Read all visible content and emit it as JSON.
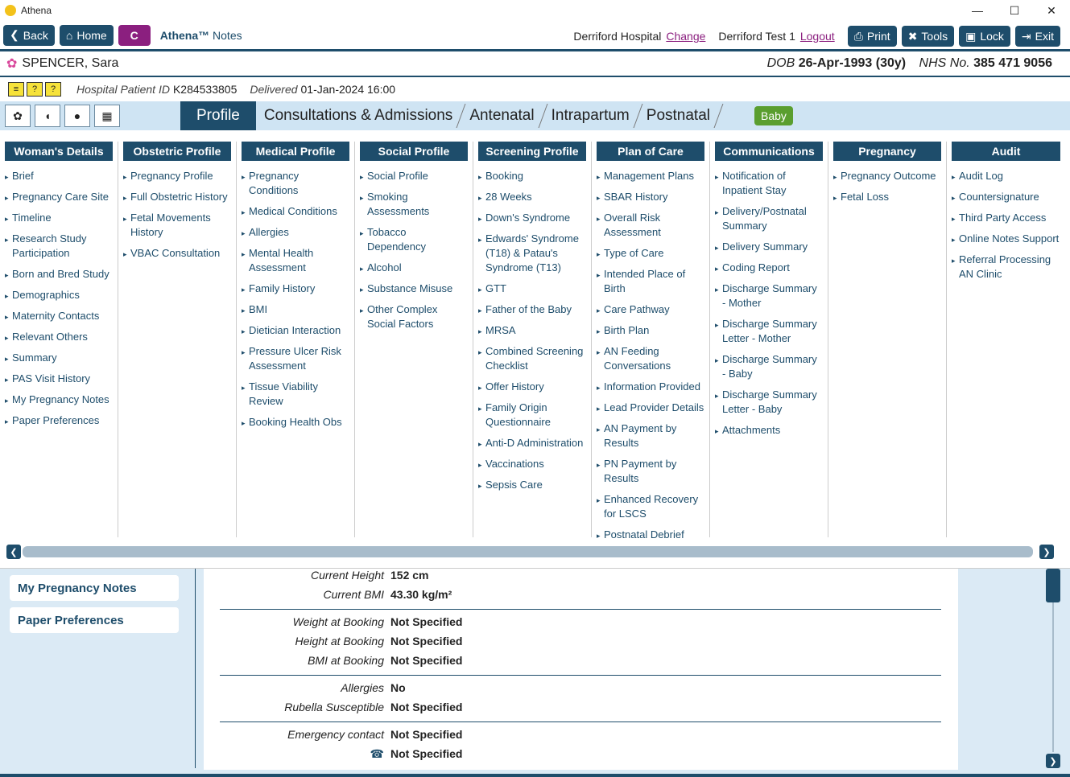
{
  "window": {
    "title": "Athena",
    "min": "—",
    "max": "☐",
    "close": "✕"
  },
  "toolbar": {
    "back": "Back",
    "home": "Home",
    "c": "C",
    "brand_name": "Athena™",
    "brand_suffix": " Notes",
    "hospital": "Derriford Hospital",
    "change": "Change",
    "user": "Derriford Test 1",
    "logout": "Logout",
    "print": "Print",
    "tools": "Tools",
    "lock": "Lock",
    "exit": "Exit"
  },
  "patient": {
    "name": "SPENCER, Sara",
    "dob_label": "DOB",
    "dob": "26-Apr-1993 (30y)",
    "nhs_label": "NHS No.",
    "nhs": "385 471 9056",
    "hospital_id_label": "Hospital Patient ID",
    "hospital_id": "K284533805",
    "delivered_label": "Delivered",
    "delivered": "01-Jan-2024 16:00"
  },
  "tabs": [
    "Profile",
    "Consultations & Admissions",
    "Antenatal",
    "Intrapartum",
    "Postnatal"
  ],
  "baby": "Baby",
  "menu": {
    "woman": {
      "title": "Woman's Details",
      "items": [
        "Brief",
        "Pregnancy Care Site",
        "Timeline",
        "Research Study Participation",
        "Born and Bred Study",
        "Demographics",
        "Maternity Contacts",
        "Relevant Others",
        "Summary",
        "PAS Visit History",
        "My Pregnancy Notes",
        "Paper Preferences"
      ]
    },
    "obstetric": {
      "title": "Obstetric Profile",
      "items": [
        "Pregnancy Profile",
        "Full Obstetric History",
        "Fetal Movements History",
        "VBAC Consultation"
      ]
    },
    "medical": {
      "title": "Medical Profile",
      "items": [
        "Pregnancy Conditions",
        "Medical Conditions",
        "Allergies",
        "Mental Health Assessment",
        "Family History",
        "BMI",
        "Dietician Interaction",
        "Pressure Ulcer Risk Assessment",
        "Tissue Viability Review",
        "Booking Health Obs"
      ]
    },
    "social": {
      "title": "Social Profile",
      "items": [
        "Social Profile",
        "Smoking Assessments",
        "Tobacco Dependency",
        "Alcohol",
        "Substance Misuse",
        "Other Complex Social Factors"
      ]
    },
    "screening": {
      "title": "Screening Profile",
      "items": [
        "Booking",
        "28 Weeks",
        "Down's Syndrome",
        "Edwards' Syndrome (T18) & Patau's Syndrome (T13)",
        "GTT",
        "Father of the Baby",
        "MRSA",
        "Combined Screening Checklist",
        "Offer History",
        "Family Origin Questionnaire",
        "Anti-D Administration",
        "Vaccinations",
        "Sepsis Care"
      ]
    },
    "plan": {
      "title": "Plan of Care",
      "items": [
        "Management Plans",
        "SBAR History",
        "Overall Risk Assessment",
        "Type of Care",
        "Intended Place of Birth",
        "Care Pathway",
        "Birth Plan",
        "AN Feeding Conversations",
        "Information Provided",
        "Lead Provider Details",
        "AN Payment by Results",
        "PN Payment by Results",
        "Enhanced Recovery for LSCS",
        "Postnatal Debrief"
      ]
    },
    "comms": {
      "title": "Communications",
      "items": [
        "Notification of Inpatient Stay",
        "Delivery/Postnatal Summary",
        "Delivery Summary",
        "Coding Report",
        "Discharge Summary - Mother",
        "Discharge Summary Letter - Mother",
        "Discharge Summary - Baby",
        "Discharge Summary Letter - Baby",
        "Attachments"
      ]
    },
    "outcome": {
      "title": "Pregnancy Outcome",
      "items": [
        "Pregnancy Outcome",
        "Fetal Loss"
      ]
    },
    "audit": {
      "title": "Audit",
      "items": [
        "Audit Log",
        "Countersignature",
        "Third Party Access",
        "Online Notes Support",
        "Referral Processing AN Clinic"
      ]
    }
  },
  "sidebar": {
    "my_notes": "My Pregnancy Notes",
    "paper_prefs": "Paper Preferences"
  },
  "details": [
    {
      "label": "Current Height",
      "value": "152 cm"
    },
    {
      "label": "Current BMI",
      "value": "43.30 kg/m²"
    },
    {
      "label": "Weight at Booking",
      "value": "Not Specified"
    },
    {
      "label": "Height at Booking",
      "value": "Not Specified"
    },
    {
      "label": "BMI at Booking",
      "value": "Not Specified"
    },
    {
      "label": "Allergies",
      "value": "No"
    },
    {
      "label": "Rubella Susceptible",
      "value": "Not Specified"
    },
    {
      "label": "Emergency contact",
      "value": "Not Specified"
    },
    {
      "label": "☎",
      "value": "Not Specified"
    }
  ]
}
